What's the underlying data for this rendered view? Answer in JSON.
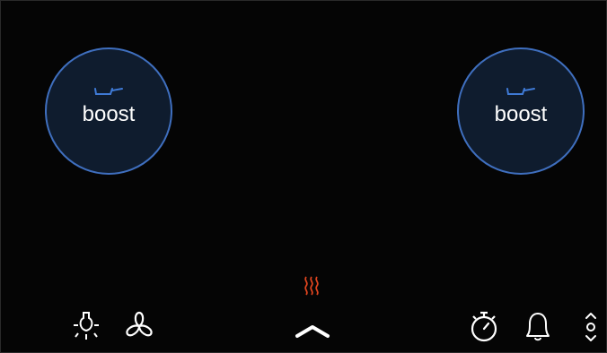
{
  "boost_left": {
    "label": "boost",
    "icon": "pan-icon"
  },
  "boost_right": {
    "label": "boost",
    "icon": "pan-icon"
  },
  "bottom_bar": {
    "icons": [
      "light-icon",
      "fan-icon",
      "heat-icon",
      "chevron-up-icon",
      "timer-icon",
      "bell-icon",
      "up-down-icon"
    ]
  },
  "colors": {
    "background": "#050505",
    "boost_fill": "#0f1c2e",
    "boost_border": "#3f6fbf",
    "heat_accent": "#e0451f",
    "icon": "#ffffff"
  }
}
